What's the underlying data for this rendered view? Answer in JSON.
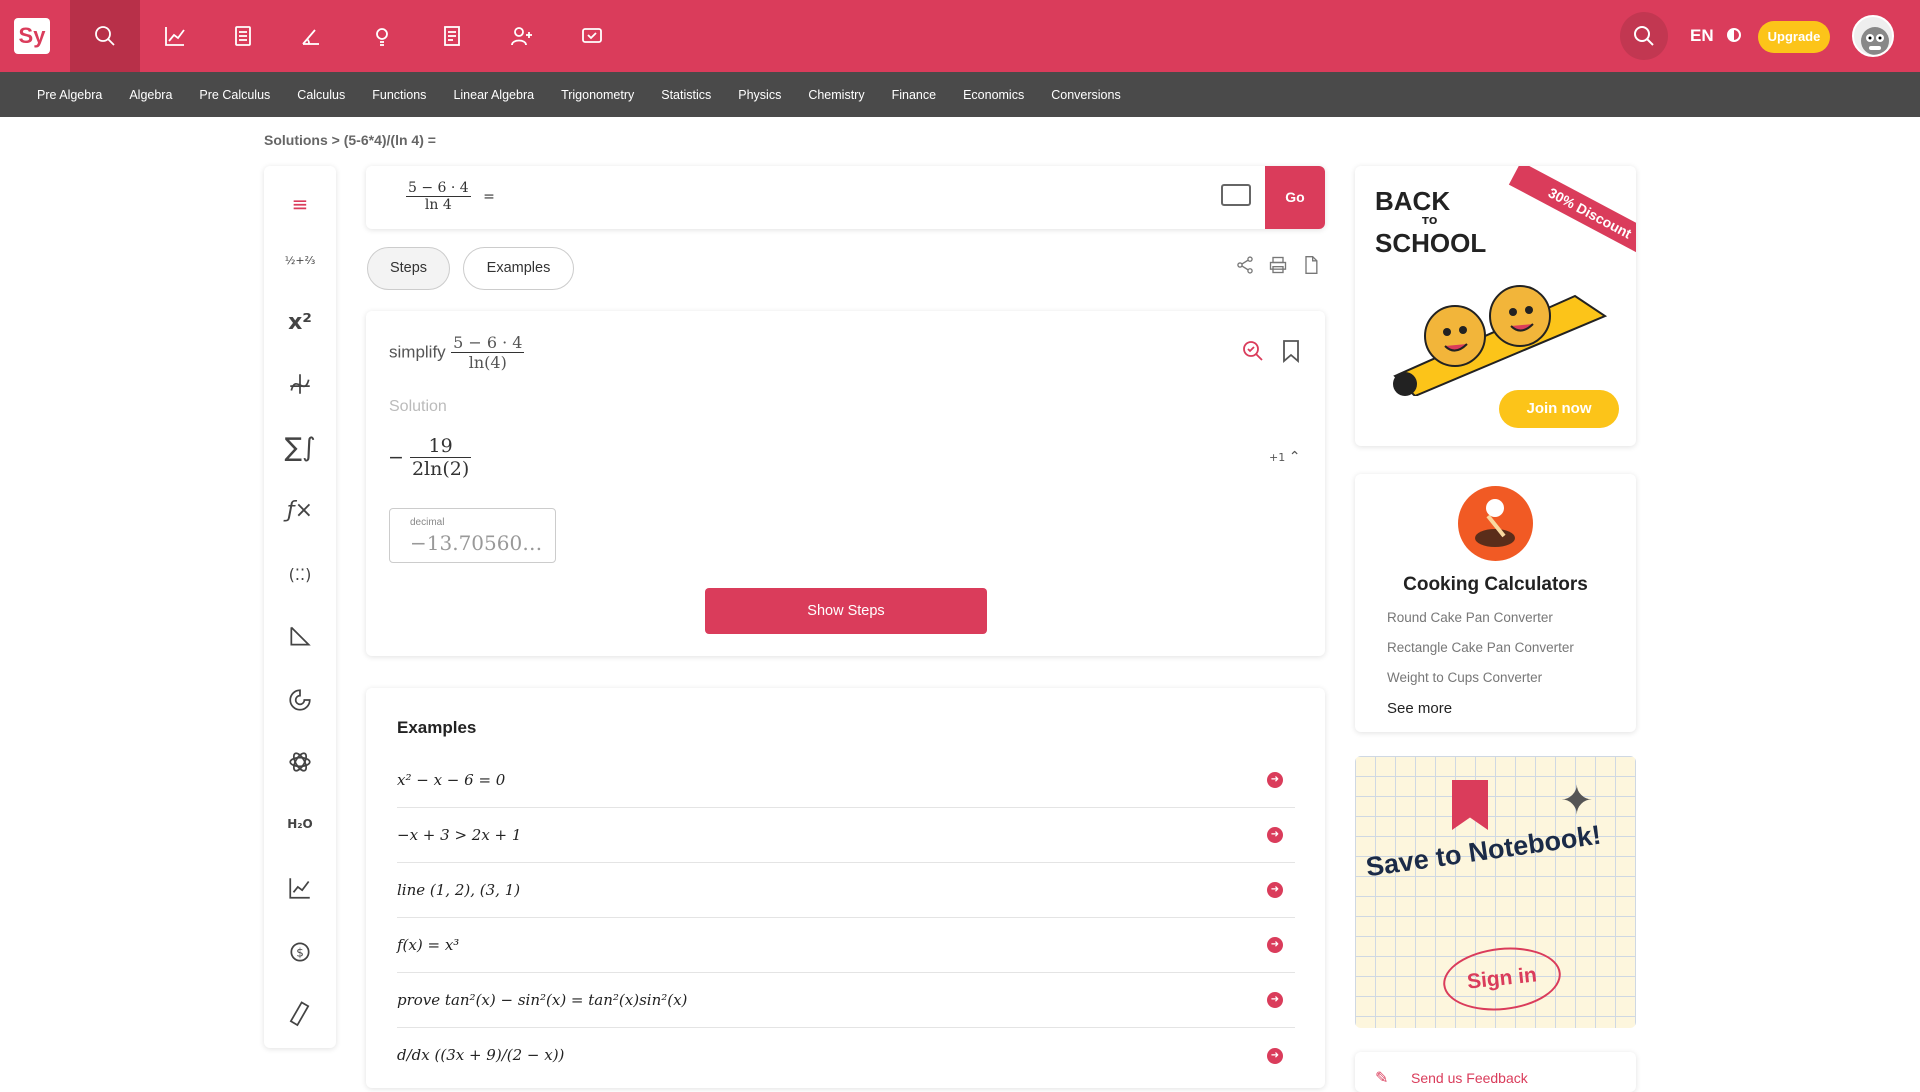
{
  "app": {
    "logo": "Sy",
    "lang": "EN",
    "upgrade": "Upgrade"
  },
  "topnav": {
    "icons": [
      "search-icon",
      "graph-icon",
      "calculator-icon",
      "geometry-icon",
      "lightbulb-icon",
      "notebook-icon",
      "user-group-icon",
      "practice-icon"
    ]
  },
  "subnav": [
    "Pre Algebra",
    "Algebra",
    "Pre Calculus",
    "Calculus",
    "Functions",
    "Linear Algebra",
    "Trigonometry",
    "Statistics",
    "Physics",
    "Chemistry",
    "Finance",
    "Economics",
    "Conversions"
  ],
  "breadcrumb": "Solutions > (5-6*4)/(ln 4) =",
  "input": {
    "numerator": "5 − 6 · 4",
    "denominator": "ln 4",
    "equals": "=",
    "go": "Go"
  },
  "tabs": {
    "steps": "Steps",
    "examples": "Examples"
  },
  "solution": {
    "simplify_label": "simplify",
    "expr_num": "5 − 6 · 4",
    "expr_den": "ln(4)",
    "solution_label": "Solution",
    "answer_sign": "−",
    "answer_num": "19",
    "answer_den": "2ln(2)",
    "alt_count": "+1",
    "decimal_label": "decimal",
    "decimal_value": "−13.70560…",
    "show_steps": "Show Steps"
  },
  "examples": {
    "title": "Examples",
    "items": [
      "x² − x − 6 = 0",
      "−x + 3 > 2x + 1",
      "line (1, 2), (3, 1)",
      "f(x) = x³",
      "prove tan²(x) − sin²(x) = tan²(x)sin²(x)",
      "d/dx ((3x + 9)/(2 − x))"
    ]
  },
  "ads": {
    "back_to_school": {
      "back": "BACK",
      "to": "TO",
      "school": "SCHOOL",
      "ribbon": "30% Discount",
      "cta": "Join now"
    },
    "cooking": {
      "title": "Cooking Calculators",
      "links": [
        "Round Cake Pan Converter",
        "Rectangle Cake Pan Converter",
        "Weight to Cups Converter"
      ],
      "more": "See more"
    },
    "notebook": {
      "title": "Save to Notebook!",
      "cta": "Sign in"
    },
    "feedback": "Send us Feedback"
  },
  "colors": {
    "brand": "#da3c5b",
    "subnav": "#4a4a4a",
    "accent": "#fcc419"
  }
}
